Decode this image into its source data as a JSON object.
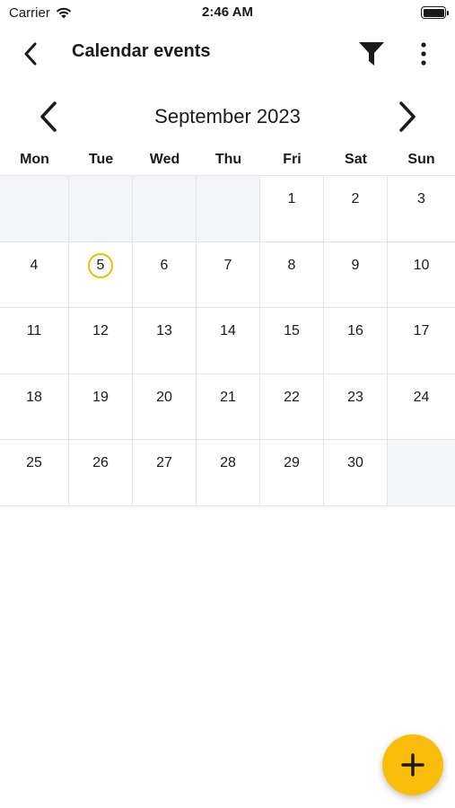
{
  "status_bar": {
    "carrier": "Carrier",
    "time": "2:46 AM"
  },
  "app_bar": {
    "title": "Calendar events",
    "icons": [
      "back-arrow-icon",
      "filter-icon",
      "more-vertical-icon"
    ]
  },
  "calendar": {
    "month_label": "September 2023",
    "weekdays": [
      "Mon",
      "Tue",
      "Wed",
      "Thu",
      "Fri",
      "Sat",
      "Sun"
    ],
    "today": "5",
    "weeks": [
      [
        "",
        "",
        "",
        "",
        "1",
        "2",
        "3"
      ],
      [
        "4",
        "5",
        "6",
        "7",
        "8",
        "9",
        "10"
      ],
      [
        "11",
        "12",
        "13",
        "14",
        "15",
        "16",
        "17"
      ],
      [
        "18",
        "19",
        "20",
        "21",
        "22",
        "23",
        "24"
      ],
      [
        "25",
        "26",
        "27",
        "28",
        "29",
        "30",
        ""
      ]
    ]
  },
  "fab": {
    "icon": "plus-icon",
    "color": "#fbbd0b"
  },
  "colors": {
    "accent": "#fbbd0b",
    "today_ring": "#f2b90c",
    "empty_cell": "#f3f5f8",
    "grid_line": "#e3e5e8"
  }
}
